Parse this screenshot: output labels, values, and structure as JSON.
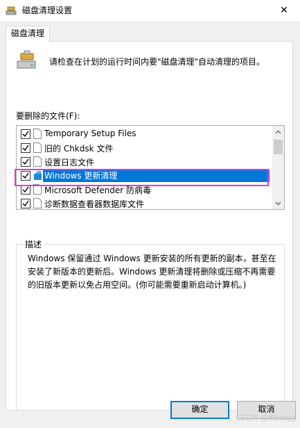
{
  "window": {
    "title": "磁盘清理设置",
    "close_glyph": "✕"
  },
  "tab": {
    "label": "磁盘清理"
  },
  "intro_text": "请检查在计划的运行时间内要\"磁盘清理\"自动清理的项目。",
  "list": {
    "label": "要删除的文件(F):",
    "items": [
      {
        "label": "Temporary Setup Files",
        "checked": true,
        "icon": "file-icon"
      },
      {
        "label": "旧的 Chkdsk 文件",
        "checked": true,
        "icon": "file-icon"
      },
      {
        "label": "设置日志文件",
        "checked": true,
        "icon": "file-icon"
      },
      {
        "label": "Windows 更新清理",
        "checked": true,
        "icon": "windows-update-icon",
        "selected": true
      },
      {
        "label": "Microsoft Defender 防病毒",
        "checked": true,
        "icon": "file-icon"
      },
      {
        "label": "诊断数据查看器数据库文件",
        "checked": true,
        "icon": "file-icon"
      }
    ]
  },
  "description": {
    "label": "描述",
    "text": "Windows 保留通过 Windows 更新安装的所有更新的副本，甚至在安装了新版本的更新后。Windows 更新清理将删除或压缩不再需要的旧版本更新以免占用空间。(你可能需要重新启动计算机。)"
  },
  "buttons": {
    "ok": "确定",
    "cancel": "取消"
  },
  "watermark": "CSDN @iKestqg",
  "colors": {
    "selection": "#0078d7",
    "highlight_box": "#e236e0"
  }
}
